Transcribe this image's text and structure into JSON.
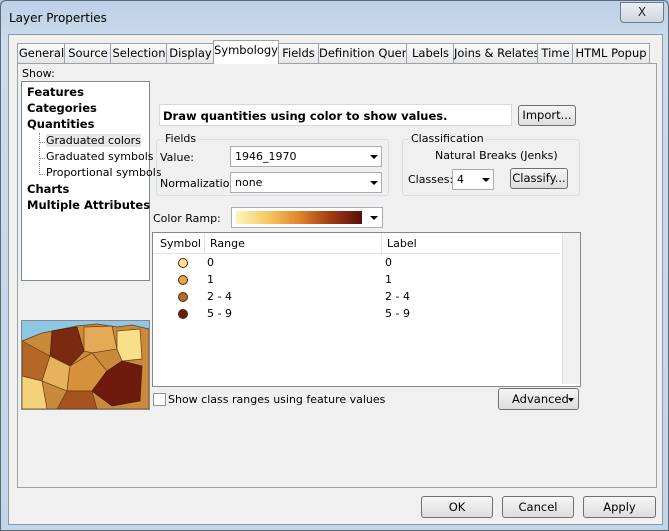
{
  "window": {
    "title": "Layer Properties",
    "close_glyph": "X"
  },
  "tabs": [
    {
      "label": "General"
    },
    {
      "label": "Source"
    },
    {
      "label": "Selection"
    },
    {
      "label": "Display"
    },
    {
      "label": "Symbology"
    },
    {
      "label": "Fields"
    },
    {
      "label": "Definition Query"
    },
    {
      "label": "Labels"
    },
    {
      "label": "Joins & Relates"
    },
    {
      "label": "Time"
    },
    {
      "label": "HTML Popup"
    }
  ],
  "show": {
    "label": "Show:",
    "tree": [
      {
        "label": "Features"
      },
      {
        "label": "Categories"
      },
      {
        "label": "Quantities"
      },
      {
        "label": "Graduated colors"
      },
      {
        "label": "Graduated symbols"
      },
      {
        "label": "Proportional symbols"
      },
      {
        "label": "Charts"
      },
      {
        "label": "Multiple Attributes"
      }
    ]
  },
  "description": "Draw quantities using color to show values.",
  "import_label": "Import...",
  "fields": {
    "legend": "Fields",
    "value_label": "Value:",
    "value": "1946_1970",
    "normalization_label": "Normalization:",
    "normalization": "none"
  },
  "classification": {
    "legend": "Classification",
    "method": "Natural Breaks (Jenks)",
    "classes_label": "Classes:",
    "classes": "4",
    "classify_label": "Classify..."
  },
  "color_ramp": {
    "label": "Color Ramp:",
    "colors": [
      "#fdf6b8",
      "#f7c866",
      "#e0852d",
      "#a13b12",
      "#5a0f0a"
    ]
  },
  "class_table": {
    "headers": {
      "symbol": "Symbol",
      "range": "Range",
      "label": "Label"
    },
    "rows": [
      {
        "color": "#fbe58a",
        "range": "0",
        "label": "0"
      },
      {
        "color": "#e8a444",
        "range": "1",
        "label": "1"
      },
      {
        "color": "#b86a2a",
        "range": "2 - 4",
        "label": "2 - 4"
      },
      {
        "color": "#6e1a0e",
        "range": "5 - 9",
        "label": "5 - 9"
      }
    ]
  },
  "show_class_ranges": "Show class ranges using feature values",
  "advanced_label": "Advanced",
  "footer": {
    "ok": "OK",
    "cancel": "Cancel",
    "apply": "Apply"
  }
}
